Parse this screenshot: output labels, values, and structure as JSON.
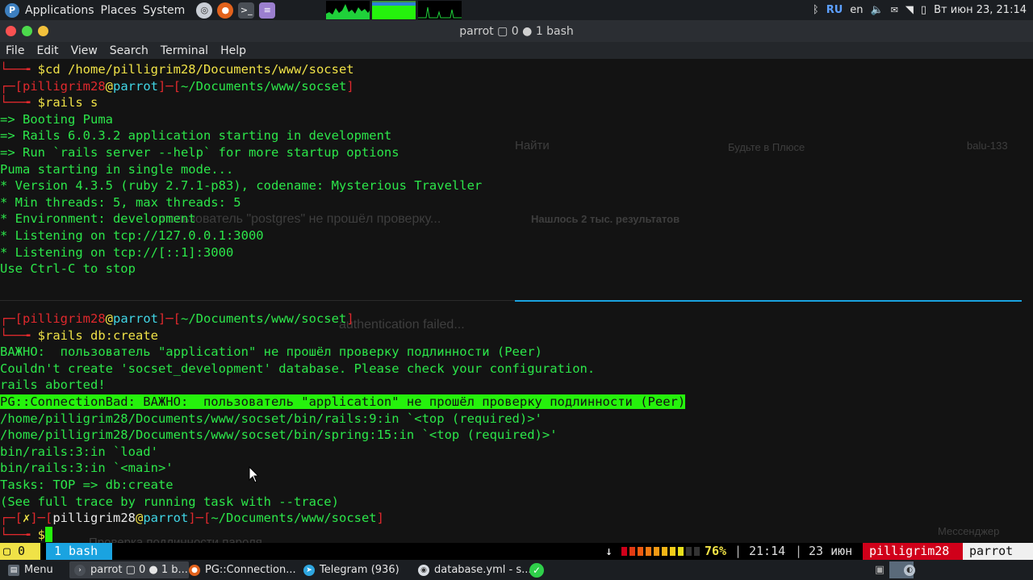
{
  "top_panel": {
    "menus": [
      "Applications",
      "Places",
      "System"
    ],
    "launchers": [
      "browser-icon",
      "firefox-icon",
      "terminal-icon",
      "text-editor-icon"
    ],
    "tray": {
      "lang_code": "RU",
      "lang_label": "en",
      "clock": "Вт июн 23, 21:14"
    }
  },
  "window": {
    "title": "parrot ▢ 0 ● 1 bash",
    "menu": [
      "File",
      "Edit",
      "View",
      "Search",
      "Terminal",
      "Help"
    ]
  },
  "terminal": {
    "pane1": {
      "cmd1": "$cd /home/pilligrim28/Documents/www/socset",
      "user": "pilligrim28",
      "host": "parrot",
      "path": "~/Documents/www/socset",
      "cmd2": "$rails s",
      "output": [
        "=> Booting Puma",
        "=> Rails 6.0.3.2 application starting in development",
        "=> Run `rails server --help` for more startup options",
        "Puma starting in single mode...",
        "* Version 4.3.5 (ruby 2.7.1-p83), codename: Mysterious Traveller",
        "* Min threads: 5, max threads: 5",
        "* Environment: development",
        "* Listening on tcp://127.0.0.1:3000",
        "* Listening on tcp://[::1]:3000",
        "Use Ctrl-C to stop"
      ]
    },
    "pane2": {
      "user": "pilligrim28",
      "host": "parrot",
      "path": "~/Documents/www/socset",
      "cmd": "$rails db:create",
      "output_before": [
        "ВАЖНО:  пользователь \"application\" не прошёл проверку подлинности (Peer)",
        "Couldn't create 'socset_development' database. Please check your configuration.",
        "rails aborted!"
      ],
      "highlight": "PG::ConnectionBad: ВАЖНО:  пользователь \"application\" не прошёл проверку подлинности (Peer)",
      "output_after": [
        "/home/pilligrim28/Documents/www/socset/bin/rails:9:in `<top (required)>'",
        "/home/pilligrim28/Documents/www/socset/bin/spring:15:in `<top (required)>'",
        "bin/rails:3:in `load'",
        "bin/rails:3:in `<main>'",
        "Tasks: TOP => db:create",
        "(See full trace by running task with --trace)"
      ],
      "fail_mark": "✗",
      "prompt_symbol": "$"
    },
    "ghost_text": [
      "Найти",
      "Будьте в Плюсе",
      "balu-133",
      "Нашлось 2 тыс. результатов",
      "пользователь \"postgres\" не прошёл проверку...",
      "authentication failed...",
      "Мессенджер",
      "Проверка подлинности пароля..."
    ]
  },
  "tmux": {
    "left_badge": "▢ 0",
    "window_tab": "1 bash",
    "arrow": "↓",
    "battery_percent": 76,
    "battery_label": "76%",
    "time": "21:14",
    "date": "23 июн",
    "user": "pilligrim28",
    "host": "parrot",
    "colors": {
      "user_bg": "#d0001a",
      "host_bg": "#f0f0f0",
      "tab_bg": "#1aa3e0",
      "badge_bg": "#f0e247"
    }
  },
  "taskbar": {
    "menu_label": "Menu",
    "tasks": [
      {
        "label": "parrot ▢ 0 ● 1 b...",
        "icon": "terminal-icon"
      },
      {
        "label": "PG::Connection...",
        "icon": "firefox-icon"
      },
      {
        "label": "Telegram (936)",
        "icon": "telegram-icon"
      },
      {
        "label": "database.yml - s...",
        "icon": "editor-icon"
      }
    ]
  }
}
